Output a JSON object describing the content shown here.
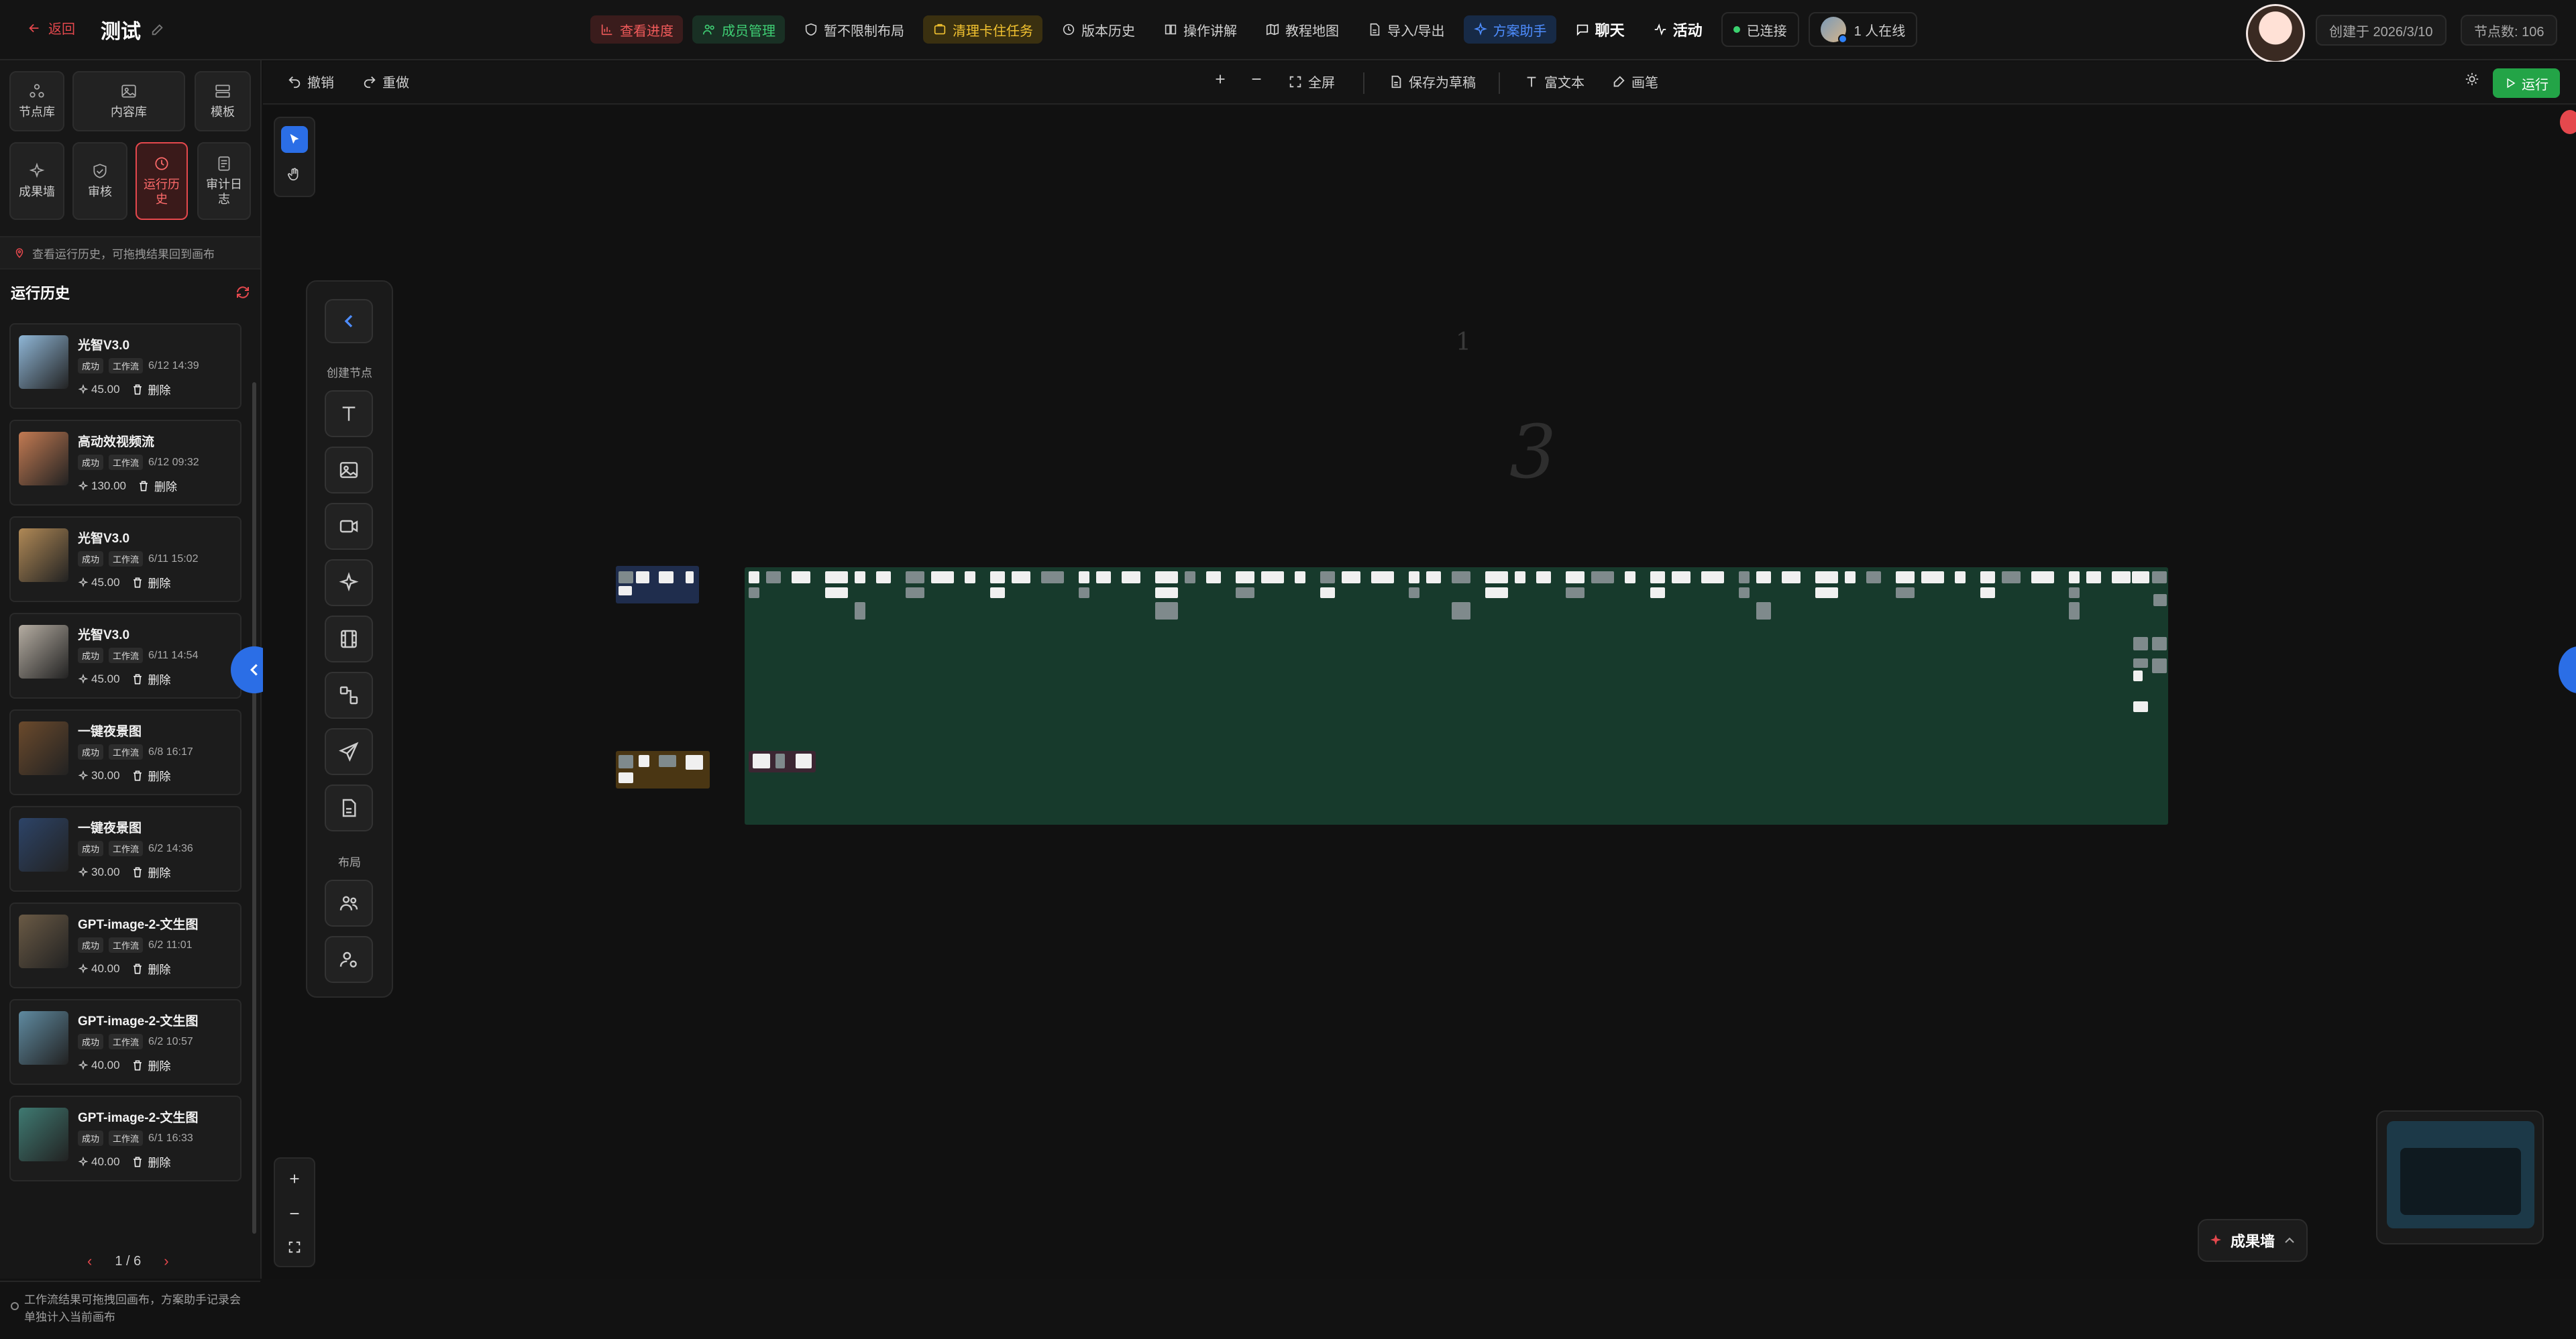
{
  "header": {
    "back_label": "返回",
    "title": "测试",
    "menu": [
      {
        "label": "查看进度",
        "icon": "chart-icon",
        "style": "red"
      },
      {
        "label": "成员管理",
        "icon": "users-icon",
        "style": "green"
      },
      {
        "label": "暂不限制布局",
        "icon": "shield-icon",
        "style": ""
      },
      {
        "label": "清理卡住任务",
        "icon": "broom-icon",
        "style": "yellow"
      },
      {
        "label": "版本历史",
        "icon": "history-icon",
        "style": ""
      },
      {
        "label": "操作讲解",
        "icon": "book-icon",
        "style": ""
      },
      {
        "label": "教程地图",
        "icon": "map-icon",
        "style": ""
      },
      {
        "label": "导入/导出",
        "icon": "file-icon",
        "style": ""
      },
      {
        "label": "方案助手",
        "icon": "sparkle-icon",
        "style": "blue"
      },
      {
        "label": "聊天",
        "icon": "chat-icon",
        "style": "bold"
      },
      {
        "label": "活动",
        "icon": "activity-icon",
        "style": "bold"
      }
    ],
    "connection": "已连接",
    "online": "1 人在线",
    "created": "创建于 2026/3/10",
    "node_count": "节点数: 106"
  },
  "sidebar": {
    "tiles": [
      "节点库",
      "内容库",
      "模板",
      "成果墙",
      "审核",
      "运行历史",
      "审计日志"
    ],
    "tip": "查看运行历史，可拖拽结果回到画布",
    "history_title": "运行历史",
    "history": [
      {
        "name": "光智V3.0",
        "status": "成功",
        "type": "工作流",
        "time": "6/12 14:39",
        "cost": "45.00",
        "delete": "删除",
        "thumb": "#8fb6d6"
      },
      {
        "name": "高动效视频流",
        "status": "成功",
        "type": "工作流",
        "time": "6/12 09:32",
        "cost": "130.00",
        "delete": "删除",
        "thumb": "#c27a52"
      },
      {
        "name": "光智V3.0",
        "status": "成功",
        "type": "工作流",
        "time": "6/11 15:02",
        "cost": "45.00",
        "delete": "删除",
        "thumb": "#b08956"
      },
      {
        "name": "光智V3.0",
        "status": "成功",
        "type": "工作流",
        "time": "6/11 14:54",
        "cost": "45.00",
        "delete": "删除",
        "thumb": "#b5ada2"
      },
      {
        "name": "一键夜景图",
        "status": "成功",
        "type": "工作流",
        "time": "6/8 16:17",
        "cost": "30.00",
        "delete": "删除",
        "thumb": "#6b4a2c"
      },
      {
        "name": "一键夜景图",
        "status": "成功",
        "type": "工作流",
        "time": "6/2 14:36",
        "cost": "30.00",
        "delete": "删除",
        "thumb": "#2d4468"
      },
      {
        "name": "GPT-image-2-文生图",
        "status": "成功",
        "type": "工作流",
        "time": "6/2 11:01",
        "cost": "40.00",
        "delete": "删除",
        "thumb": "#6a5a45"
      },
      {
        "name": "GPT-image-2-文生图",
        "status": "成功",
        "type": "工作流",
        "time": "6/2 10:57",
        "cost": "40.00",
        "delete": "删除",
        "thumb": "#5f8aa0"
      },
      {
        "name": "GPT-image-2-文生图",
        "status": "成功",
        "type": "工作流",
        "time": "6/1 16:33",
        "cost": "40.00",
        "delete": "删除",
        "thumb": "#3f7a72"
      }
    ],
    "pager": "1 / 6",
    "footer": "工作流结果可拖拽回画布，方案助手记录会单独计入当前画布"
  },
  "toolbar": {
    "undo": "撤销",
    "redo": "重做",
    "fullscreen": "全屏",
    "save_draft": "保存为草稿",
    "rich_text": "富文本",
    "brush": "画笔",
    "run": "运行"
  },
  "palette": {
    "create_label": "创建节点",
    "layout_label": "布局"
  },
  "canvas": {
    "annotation_small": "1",
    "annotation_large": "3",
    "group_colors": {
      "blue": "#1f2d4d",
      "green": "#173a2c",
      "brown": "#4a3613",
      "purple": "#3b2632"
    }
  },
  "achievement_label": "成果墙"
}
